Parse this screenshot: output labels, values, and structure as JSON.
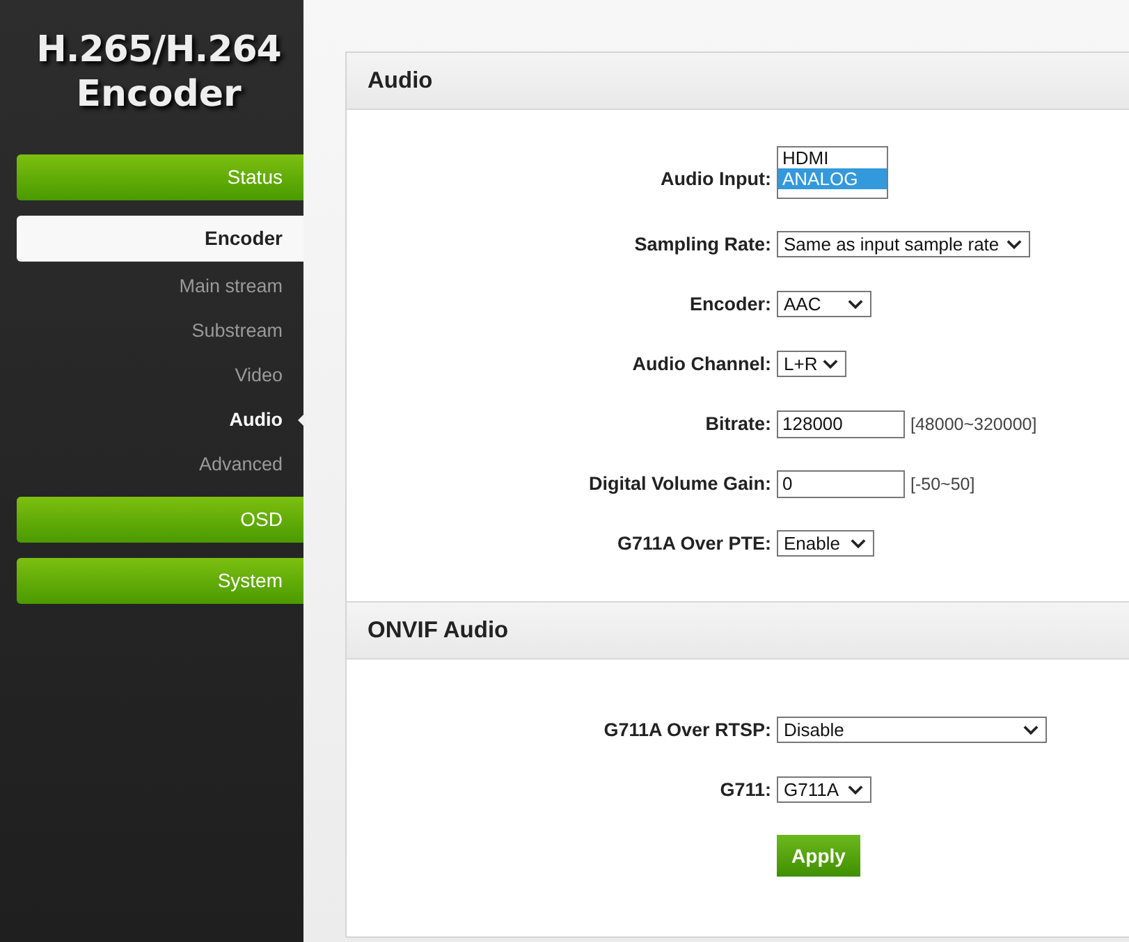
{
  "logo": {
    "line1": "H.265/H.264",
    "line2": "Encoder"
  },
  "nav": [
    {
      "label": "Status",
      "kind": "group",
      "selected": false
    },
    {
      "label": "Encoder",
      "kind": "group",
      "selected": true
    },
    {
      "label": "Main stream",
      "kind": "sub",
      "selected": false
    },
    {
      "label": "Substream",
      "kind": "sub",
      "selected": false
    },
    {
      "label": "Video",
      "kind": "sub",
      "selected": false
    },
    {
      "label": "Audio",
      "kind": "sub",
      "selected": true
    },
    {
      "label": "Advanced",
      "kind": "sub",
      "selected": false
    },
    {
      "label": "OSD",
      "kind": "group",
      "selected": false
    },
    {
      "label": "System",
      "kind": "group",
      "selected": false
    }
  ],
  "sections": [
    {
      "title": "Audio",
      "fields": [
        {
          "label": "Audio Input:",
          "kind": "listbox",
          "options": [
            {
              "label": "HDMI",
              "selected": false
            },
            {
              "label": "ANALOG",
              "selected": true
            }
          ]
        },
        {
          "label": "Sampling Rate:",
          "kind": "select",
          "value": "Same as input sample rate"
        },
        {
          "label": "Encoder:",
          "kind": "select",
          "value": "AAC"
        },
        {
          "label": "Audio Channel:",
          "kind": "select",
          "value": "L+R"
        },
        {
          "label": "Bitrate:",
          "kind": "input",
          "value": "128000",
          "hint": "[48000~320000]"
        },
        {
          "label": "Digital Volume Gain:",
          "kind": "input",
          "value": "0",
          "hint": "[-50~50]"
        },
        {
          "label": "G711A Over PTE:",
          "kind": "select",
          "value": "Enable"
        }
      ]
    },
    {
      "title": "ONVIF Audio",
      "fields": [
        {
          "label": "G711A Over RTSP:",
          "kind": "select",
          "value": "Disable"
        },
        {
          "label": "G711:",
          "kind": "select",
          "value": "G711A"
        }
      ]
    }
  ],
  "apply": "Apply"
}
